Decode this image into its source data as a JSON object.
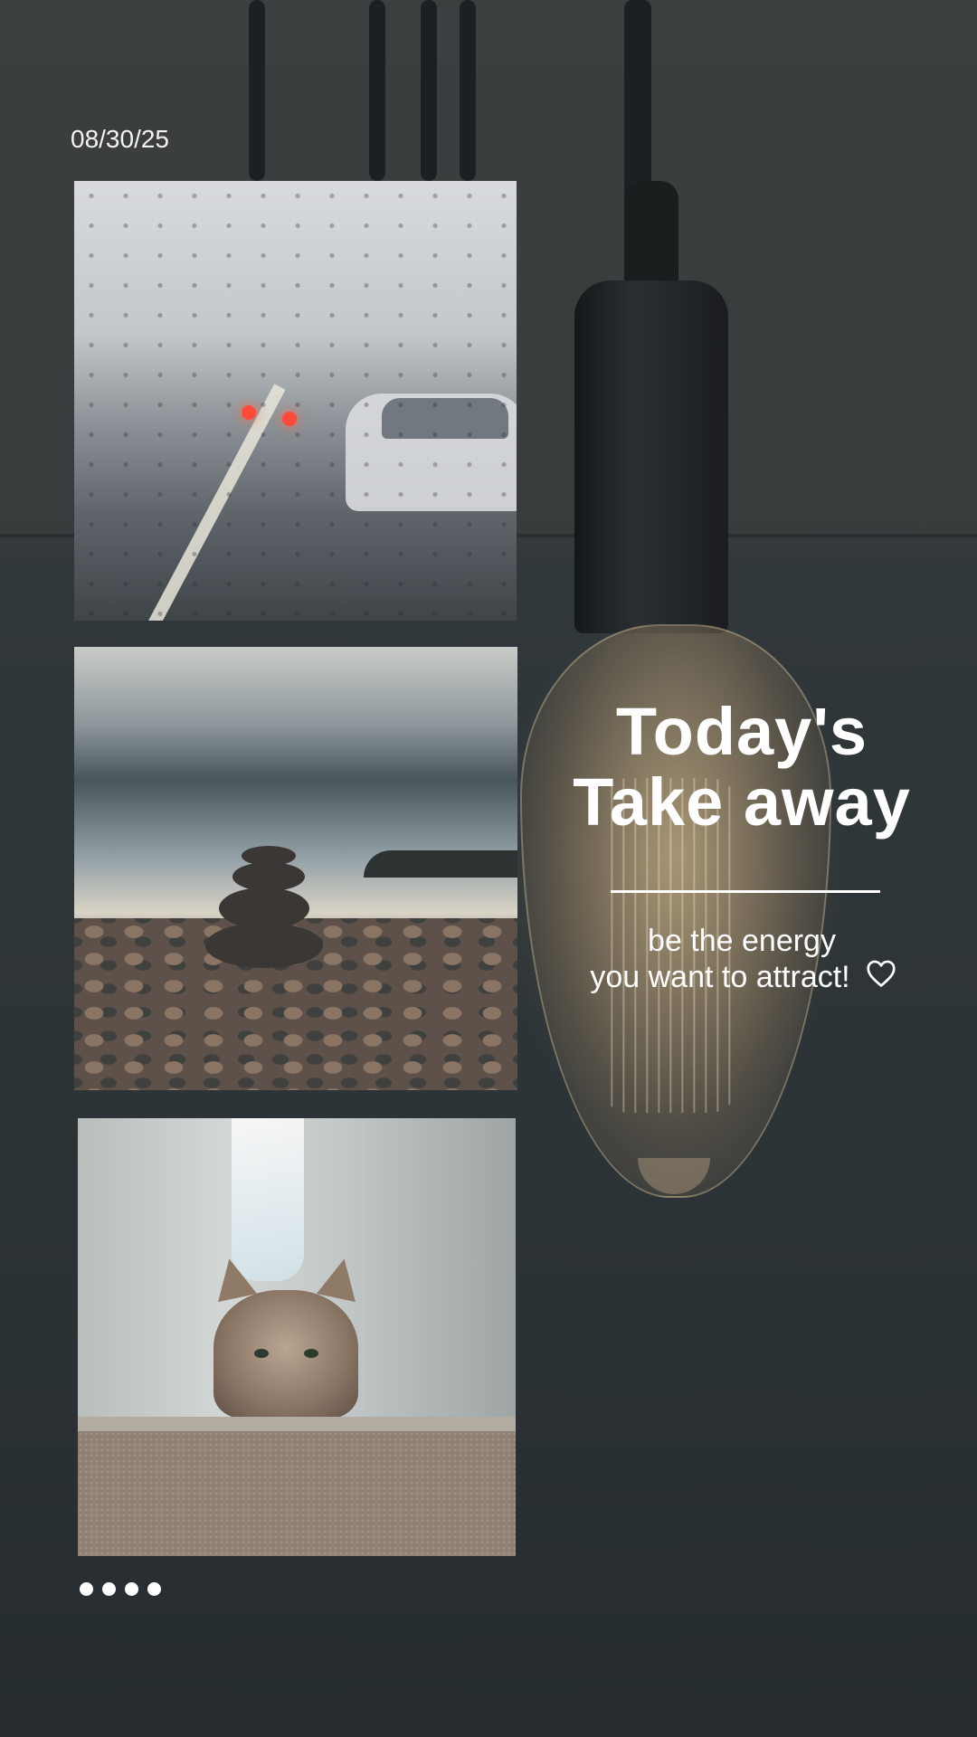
{
  "date": "08/30/25",
  "title": {
    "line1": "Today's",
    "line2": "Take away"
  },
  "tagline": {
    "line1": "be the energy",
    "line2": "you want to attract!"
  },
  "icons": {
    "heart": "heart-outline-icon",
    "page_dots": 4
  },
  "colors": {
    "background": "#2f3538",
    "text": "#ffffff"
  }
}
